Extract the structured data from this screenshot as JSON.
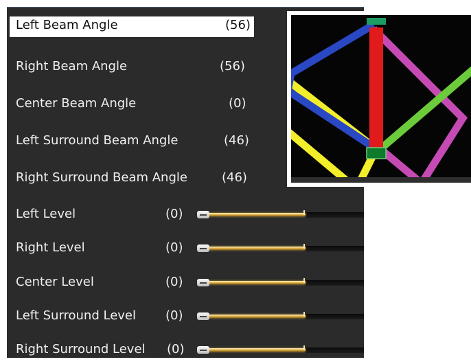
{
  "beam_angles": [
    {
      "label": "Left Beam Angle",
      "value": "(56)",
      "selected": true
    },
    {
      "label": "Right Beam Angle",
      "value": "(56)"
    },
    {
      "label": "Center Beam Angle",
      "value": "(0)"
    },
    {
      "label": "Left Surround Beam Angle",
      "value": "(46)"
    },
    {
      "label": "Right Surround Beam Angle",
      "value": "(46)"
    }
  ],
  "levels": [
    {
      "label": "Left Level",
      "value": "(0)"
    },
    {
      "label": "Right Level",
      "value": "(0)"
    },
    {
      "label": "Center Level",
      "value": "(0)"
    },
    {
      "label": "Left Surround Level",
      "value": "(0)"
    },
    {
      "label": "Right Surround Level",
      "value": "(0)"
    }
  ],
  "preview": {
    "beam_colors": {
      "left": "#2a47c4",
      "right": "#6ccb3a",
      "center": "#e11b1b",
      "left_surround": "#f3ee2a",
      "right_surround": "#c64ab4"
    }
  }
}
